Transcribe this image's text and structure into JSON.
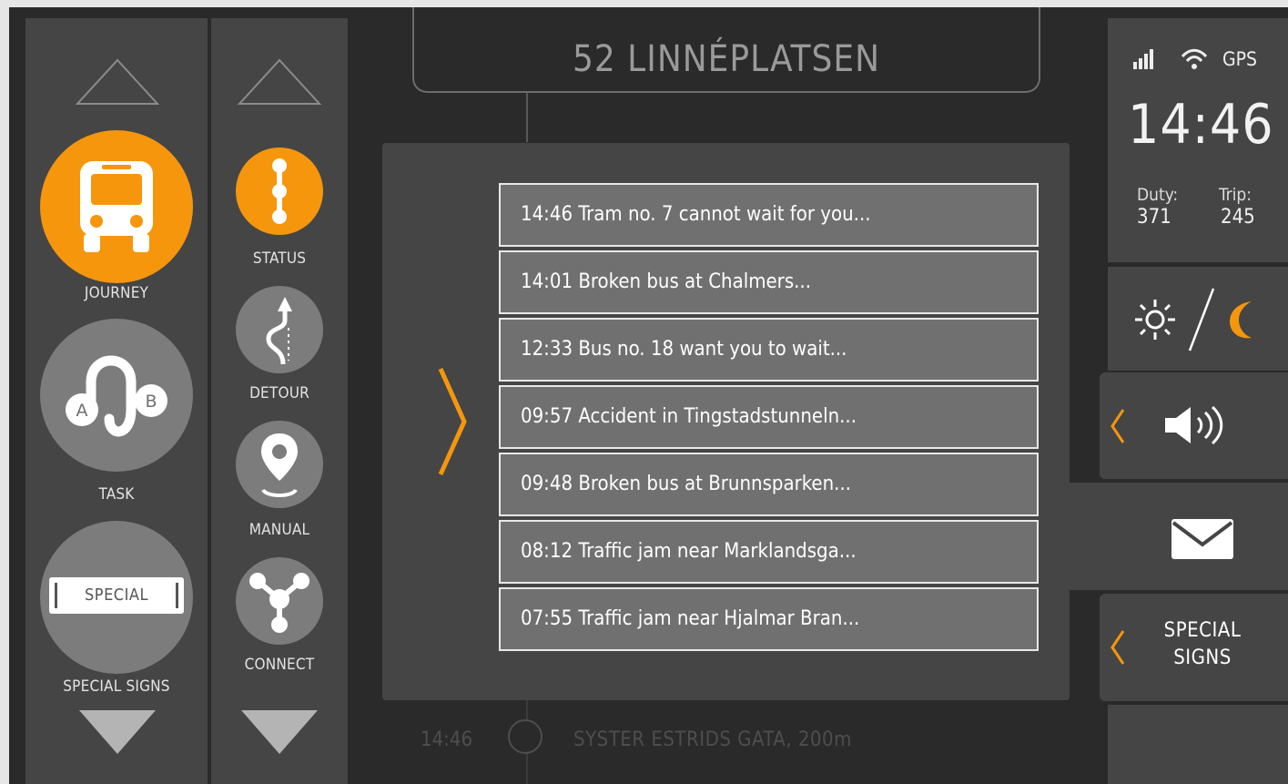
{
  "route": {
    "title": "52 LINNÉPLATSEN"
  },
  "nav_primary": [
    {
      "label": "JOURNEY",
      "icon": "bus-icon"
    },
    {
      "label": "TASK",
      "icon": "route-ab-icon"
    },
    {
      "label": "SPECIAL SIGNS",
      "icon": "special-sign-icon",
      "sign_text": "SPECIAL"
    }
  ],
  "nav_secondary": [
    {
      "label": "STATUS",
      "icon": "status-line-icon"
    },
    {
      "label": "DETOUR",
      "icon": "detour-icon"
    },
    {
      "label": "MANUAL",
      "icon": "location-pin-icon"
    },
    {
      "label": "CONNECT",
      "icon": "connect-icon"
    }
  ],
  "messages": [
    "14:46 Tram no. 7 cannot wait for you...",
    "14:01 Broken bus at Chalmers...",
    "12:33 Bus no. 18 want you to wait...",
    "09:57 Accident in Tingstadstunneln...",
    "09:48 Broken bus at Brunnsparken...",
    "08:12 Traffic jam near Marklandsga...",
    "07:55 Traffic jam near Hjalmar Bran..."
  ],
  "next_stop": {
    "time": "14:46",
    "name": "SYSTER ESTRIDS GATA, 200m"
  },
  "status": {
    "gps_label": "GPS",
    "clock": "14:46",
    "duty_label": "Duty:",
    "duty_value": "371",
    "trip_label": "Trip:",
    "trip_value": "245"
  },
  "special_signs_button": {
    "line1": "SPECIAL",
    "line2": "SIGNS"
  },
  "colors": {
    "accent": "#f5960d",
    "background": "#2a2a2a",
    "panel": "#454545",
    "message_bg": "#707070"
  }
}
